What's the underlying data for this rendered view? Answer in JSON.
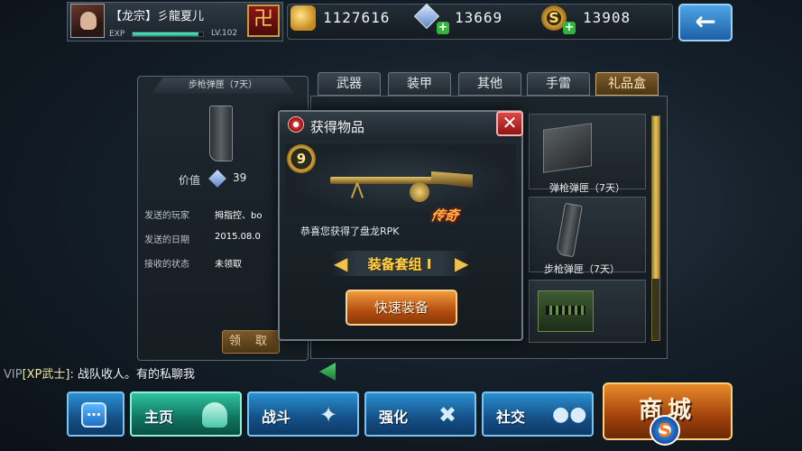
{
  "player": {
    "name": "【龙宗】彡龍夏儿",
    "exp_label": "EXP",
    "exp_progress": 0.93,
    "level": "LV.102",
    "clan_emblem_icon": "clan-emblem-icon"
  },
  "currency": {
    "gold": "1127616",
    "gems": "13669",
    "coins": "13908"
  },
  "back_button_icon": "back-arrow-icon",
  "detail": {
    "title": "步枪弹匣（7天）",
    "value_label": "价值",
    "value": "39",
    "rows": [
      {
        "key": "发送的玩家",
        "value": "拇指控、bo"
      },
      {
        "key": "发送的日期",
        "value": "2015.08.0"
      },
      {
        "key": "接收的状态",
        "value": "未领取"
      }
    ],
    "claim_label": "领 取"
  },
  "tabs": [
    "武器",
    "装甲",
    "其他",
    "手雷",
    "礼品盒"
  ],
  "active_tab": "礼品盒",
  "grid": {
    "items": [
      {
        "label": "弹枪弹匣（7天）"
      },
      {
        "label": "步枪弹匣（7天）"
      }
    ]
  },
  "modal": {
    "title": "获得物品",
    "rank": "9",
    "legend_tag": "传奇",
    "obtained_text": "恭喜您获得了盘龙RPK",
    "set_label": "装备套组 I",
    "equip_label": "快速装备"
  },
  "chat": {
    "vip": "VIP",
    "tag": "[XP武士]:",
    "message": " 战队收人。有的私聊我"
  },
  "nav": {
    "home": "主页",
    "battle": "战斗",
    "upgrade": "强化",
    "social": "社交",
    "shop": "商城"
  },
  "colors": {
    "accent_blue": "#1d5fa4",
    "accent_orange": "#b34e10",
    "legend_orange": "#ffb347",
    "set_gold": "#ffd24a"
  }
}
